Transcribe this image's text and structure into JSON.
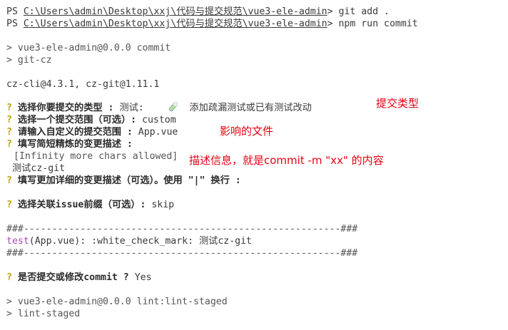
{
  "terminal": {
    "line1": {
      "prompt": "PS ",
      "path": "C:\\Users\\admin\\Desktop\\xxj\\代码与提交规范\\vue3-ele-admin",
      "command": "> git add ."
    },
    "line2": {
      "prompt": "PS ",
      "path": "C:\\Users\\admin\\Desktop\\xxj\\代码与提交规范\\vue3-ele-admin",
      "command": "> npm run commit"
    },
    "script_line1": "> vue3-ele-admin@0.0.0 commit",
    "script_line2": "> git-cz",
    "version": "cz-cli@4.3.1, cz-git@1.11.1",
    "q_mark": "?",
    "q_type": {
      "label": "选择你要提交的类型 :",
      "value": " 测试:",
      "desc": "添加疏漏测试或已有测试改动"
    },
    "q_scope": {
      "label": "选择一个提交范围（可选）:",
      "value": " custom"
    },
    "q_custom_scope": {
      "label": "请输入自定义的提交范围 :",
      "value": " App.vue"
    },
    "q_subject": {
      "label": "填写简短精炼的变更描述 :"
    },
    "subject_hint": "[Infinity more chars allowed]",
    "subject_value": "测试cz-git",
    "q_body": {
      "label": "填写更加详细的变更描述（可选）。使用 \"|\" 换行 :"
    },
    "q_issue": {
      "label": "选择关联issue前缀（可选）:",
      "value": " skip"
    },
    "divider": "###--------------------------------------------------------###",
    "commit_type": "test",
    "commit_rest": "(App.vue): :white_check_mark: 测试cz-git",
    "q_confirm": {
      "label": "是否提交或修改commit ?",
      "value": " Yes"
    },
    "lint_line1": "> vue3-ele-admin@0.0.0 lint:lint-staged",
    "lint_line2": "> lint-staged"
  },
  "annotations": {
    "type": "提交类型",
    "scope": "影响的文件",
    "subject": "描述信息，就是commit -m \"xx\" 的内容"
  },
  "colors": {
    "annotation": "#e60012",
    "question_mark": "#b9a40c",
    "test_keyword": "#a34ab3"
  },
  "icons": [
    "test-tube-icon"
  ]
}
